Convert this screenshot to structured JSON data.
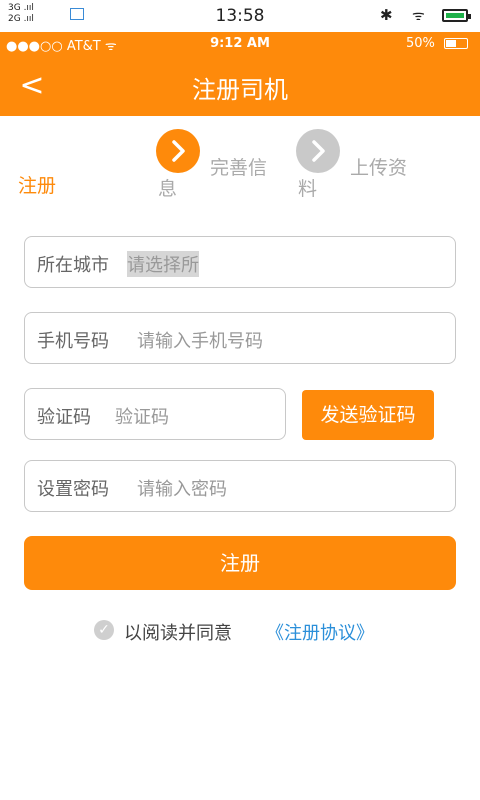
{
  "system_bar": {
    "network_top": "3G",
    "network_bottom": "2G",
    "time": "13:58"
  },
  "ios_bar": {
    "carrier": "●●●○○ AT&T ᯤ",
    "time": "9:12 AM",
    "battery": "50%"
  },
  "nav": {
    "back_glyph": "<",
    "title": "注册司机"
  },
  "steps": [
    {
      "label": "注册"
    },
    {
      "label_line1": "完善信",
      "label_line2": "息",
      "icon": "chevron-right-icon",
      "color": "#fe8a0b"
    },
    {
      "label_line1": "上传资",
      "label_line2": "料",
      "icon": "chevron-right-icon",
      "color": "#c9c9c9"
    }
  ],
  "form": {
    "city": {
      "label": "所在城市",
      "placeholder": "请选择所"
    },
    "phone": {
      "label": "手机号码",
      "placeholder": "请输入手机号码"
    },
    "code": {
      "label": "验证码",
      "placeholder": "验证码"
    },
    "send_code_label": "发送验证码",
    "password": {
      "label": "设置密码",
      "placeholder": "请输入密码"
    },
    "submit_label": "注册"
  },
  "agreement": {
    "text": "以阅读并同意",
    "link": "《注册协议》"
  },
  "colors": {
    "accent": "#fe8a0b",
    "link": "#2b8fd9"
  }
}
